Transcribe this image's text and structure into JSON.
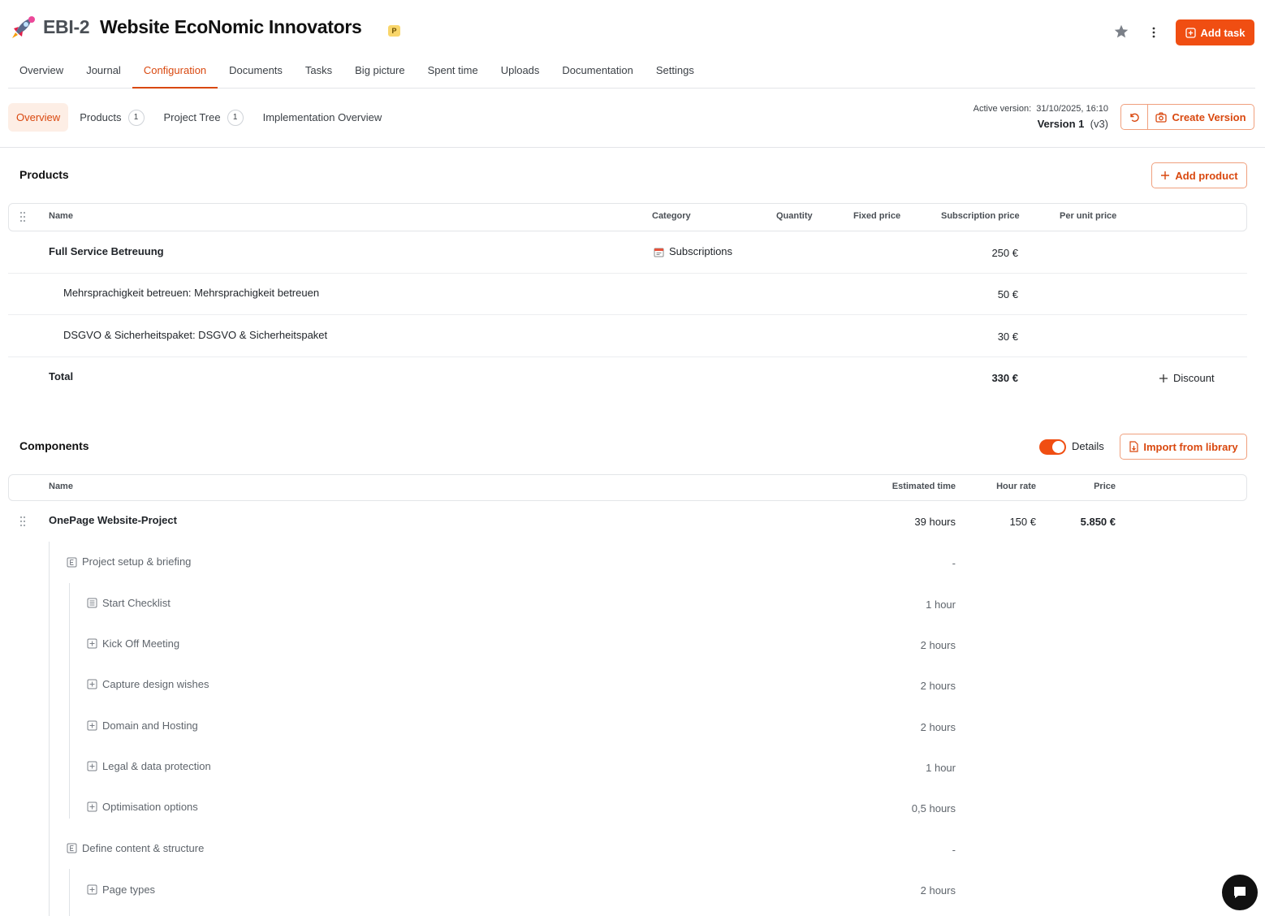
{
  "project": {
    "key": "EBI-2",
    "title": "Website EcoNomic Innovators",
    "badge": "P",
    "add_task_label": "Add task"
  },
  "nav": [
    "Overview",
    "Journal",
    "Configuration",
    "Documents",
    "Tasks",
    "Big picture",
    "Spent time",
    "Uploads",
    "Documentation",
    "Settings"
  ],
  "nav_active": "Configuration",
  "subnav": {
    "overview": "Overview",
    "products": "Products",
    "products_count": "1",
    "project_tree": "Project Tree",
    "project_tree_count": "1",
    "implementation": "Implementation Overview"
  },
  "version": {
    "label": "Active version:",
    "date": "31/10/2025, 16:10",
    "name": "Version 1",
    "rev": "(v3)",
    "create_label": "Create Version"
  },
  "products": {
    "title": "Products",
    "add_label": "Add product",
    "headers": {
      "name": "Name",
      "category": "Category",
      "quantity": "Quantity",
      "fixed": "Fixed price",
      "subscription": "Subscription price",
      "per_unit": "Per unit price"
    },
    "rows": [
      {
        "name": "Full Service Betreuung",
        "category": "Subscriptions",
        "subscription": "250 €"
      },
      {
        "name": "Mehrsprachigkeit betreuen:  Mehrsprachigkeit betreuen",
        "subscription": "50 €"
      },
      {
        "name": "DSGVO & Sicherheitspaket:  DSGVO & Sicherheitspaket",
        "subscription": "30 €"
      }
    ],
    "total_label": "Total",
    "total_value": "330 €",
    "discount_label": "Discount"
  },
  "components": {
    "title": "Components",
    "details_label": "Details",
    "import_label": "Import from library",
    "headers": {
      "name": "Name",
      "time": "Estimated time",
      "rate": "Hour rate",
      "price": "Price"
    },
    "root": {
      "name": "OnePage Website-Project",
      "time": "39 hours",
      "rate": "150 €",
      "price": "5.850 €"
    },
    "items": [
      {
        "name": "Project setup & briefing",
        "time": "-"
      },
      {
        "name": "Start Checklist",
        "time": "1 hour"
      },
      {
        "name": "Kick Off Meeting",
        "time": "2 hours"
      },
      {
        "name": "Capture design wishes",
        "time": "2 hours"
      },
      {
        "name": "Domain and Hosting",
        "time": "2 hours"
      },
      {
        "name": "Legal & data protection",
        "time": "1 hour"
      },
      {
        "name": "Optimisation options",
        "time": "0,5 hours"
      },
      {
        "name": "Define content & structure",
        "time": "-"
      },
      {
        "name": "Page types",
        "time": "2 hours"
      }
    ]
  }
}
